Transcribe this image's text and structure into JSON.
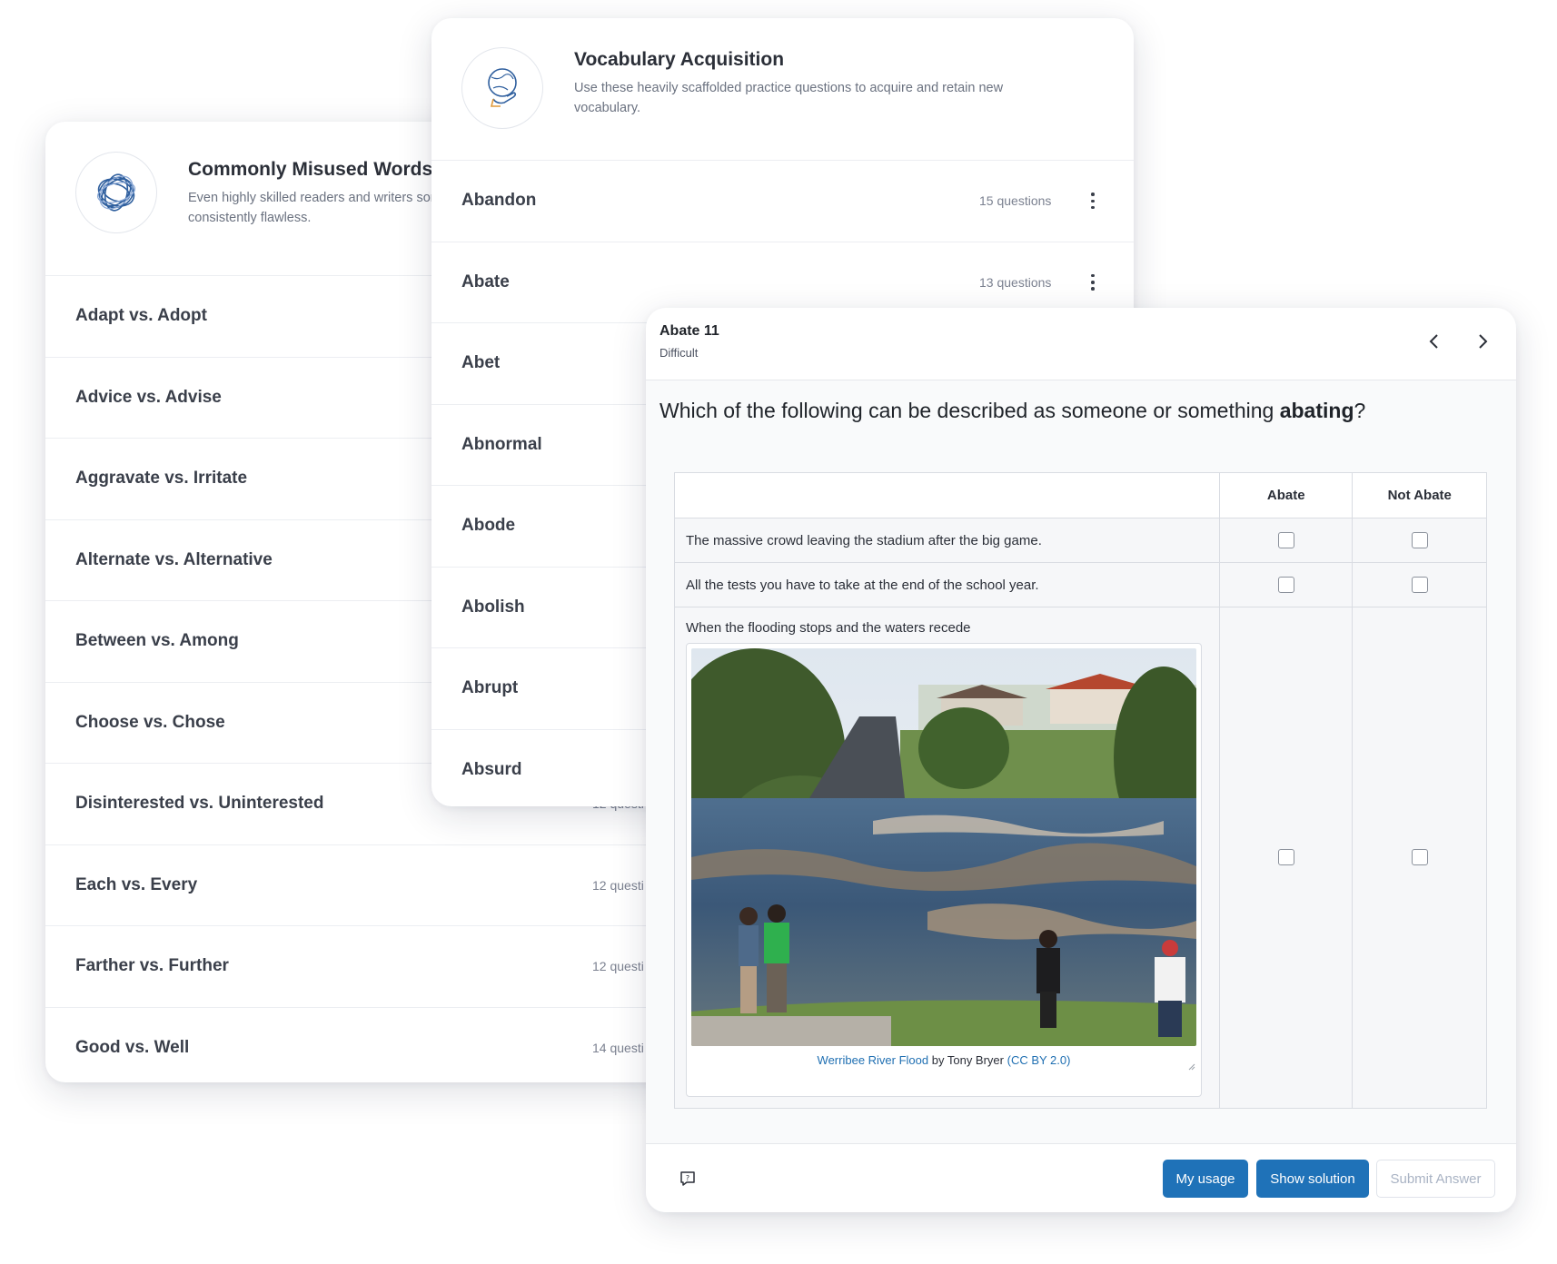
{
  "misused": {
    "title": "Commonly Misused Words",
    "description": "Even highly skilled readers and writers sor deep practice, you can ensure that your gr consistently flawless.",
    "items": [
      {
        "label": "Adapt vs. Adopt",
        "count": ""
      },
      {
        "label": "Advice vs. Advise",
        "count": ""
      },
      {
        "label": "Aggravate vs. Irritate",
        "count": ""
      },
      {
        "label": "Alternate vs. Alternative",
        "count": ""
      },
      {
        "label": "Between vs. Among",
        "count": ""
      },
      {
        "label": "Choose vs. Chose",
        "count": ""
      },
      {
        "label": "Disinterested vs. Uninterested",
        "count": "12 questi"
      },
      {
        "label": "Each vs. Every",
        "count": "12 questi"
      },
      {
        "label": "Farther vs. Further",
        "count": "12 questi"
      },
      {
        "label": "Good vs. Well",
        "count": "14 questi"
      }
    ]
  },
  "vocab": {
    "title": "Vocabulary Acquisition",
    "description": "Use these heavily scaffolded practice questions to acquire and retain new vocabulary.",
    "items": [
      {
        "label": "Abandon",
        "count": "15 questions"
      },
      {
        "label": "Abate",
        "count": "13 questions"
      },
      {
        "label": "Abet",
        "count": ""
      },
      {
        "label": "Abnormal",
        "count": ""
      },
      {
        "label": "Abode",
        "count": ""
      },
      {
        "label": "Abolish",
        "count": ""
      },
      {
        "label": "Abrupt",
        "count": ""
      },
      {
        "label": "Absurd",
        "count": ""
      }
    ]
  },
  "question": {
    "title": "Abate 11",
    "difficulty": "Difficult",
    "prompt_before": "Which of the following can be described as someone or something ",
    "prompt_bold": "abating",
    "prompt_after": "?",
    "columns": [
      "Abate",
      "Not Abate"
    ],
    "rows": [
      "The massive crowd leaving the stadium after the big game.",
      "All the tests you have to take at the end of the school year.",
      "When the flooding stops and the waters recede"
    ],
    "image_caption": {
      "link": "Werribee River Flood",
      "by": " by Tony Bryer ",
      "license": "(CC BY 2.0)"
    }
  },
  "footer": {
    "my_usage": "My usage",
    "show_solution": "Show solution",
    "submit": "Submit Answer"
  },
  "colors": {
    "primary": "#1f72b8",
    "link": "#1f6fb2"
  }
}
